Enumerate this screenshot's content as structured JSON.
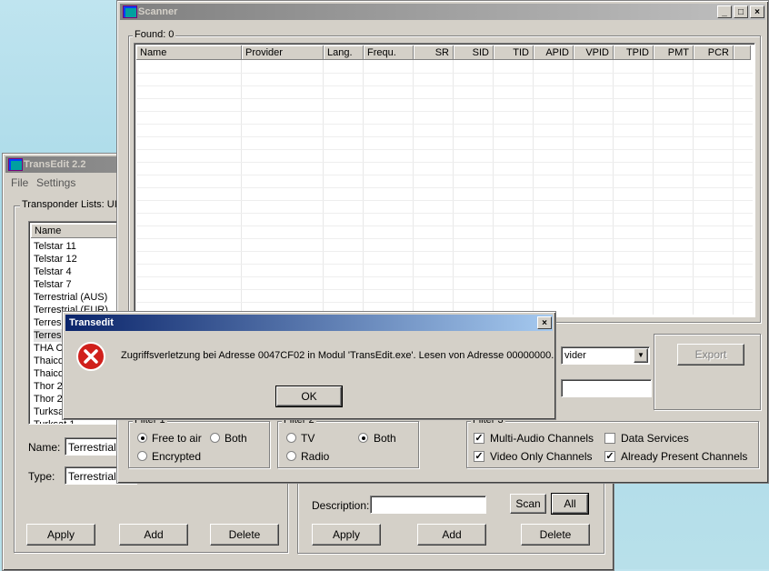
{
  "transedit": {
    "title": "TransEdit 2.2",
    "menu": [
      "File",
      "Settings"
    ],
    "group_label": "Transponder Lists:  UI",
    "list_header": "Name",
    "list_items": [
      "Telstar 11",
      "Telstar 12",
      "Telstar 4",
      "Telstar 7",
      "Terrestrial (AUS)",
      "Terrestrial (EUR)",
      "Terres",
      "Terres",
      "THA C",
      "Thaico",
      "Thaico",
      "Thor 2",
      "Thor 2",
      "Turksa",
      "Turksat 1"
    ],
    "name_label": "Name:",
    "name_value": "Terrestrial (U",
    "type_label": "Type:",
    "type_value": "Terrestrial",
    "apply": "Apply",
    "add": "Add",
    "delete": "Delete",
    "description_label": "Description:",
    "scan": "Scan",
    "all": "All",
    "apply2": "Apply",
    "add2": "Add",
    "delete2": "Delete"
  },
  "scanner": {
    "title": "Scanner",
    "found_label": "Found:  0",
    "columns": [
      "Name",
      "Provider",
      "Lang.",
      "Frequ.",
      "SR",
      "SID",
      "TID",
      "APID",
      "VPID",
      "TPID",
      "PMT",
      "PCR"
    ],
    "provider_combo": "vider",
    "export": "Export",
    "filter1": {
      "label": "Filter 1",
      "free_to_air": "Free to air",
      "both": "Both",
      "encrypted": "Encrypted"
    },
    "filter2": {
      "label": "Filter 2",
      "tv": "TV",
      "both": "Both",
      "radio": "Radio"
    },
    "filter3": {
      "label": "Filter 3",
      "multi_audio": "Multi-Audio Channels",
      "data_services": "Data Services",
      "video_only": "Video Only Channels",
      "already_present": "Already Present Channels"
    }
  },
  "dialog": {
    "title": "Transedit",
    "message": "Zugriffsverletzung bei Adresse 0047CF02 in Modul 'TransEdit.exe'. Lesen von Adresse 00000000.",
    "ok": "OK"
  },
  "colors": {
    "error_red": "#d0201c",
    "active_title": "#0a246a"
  }
}
